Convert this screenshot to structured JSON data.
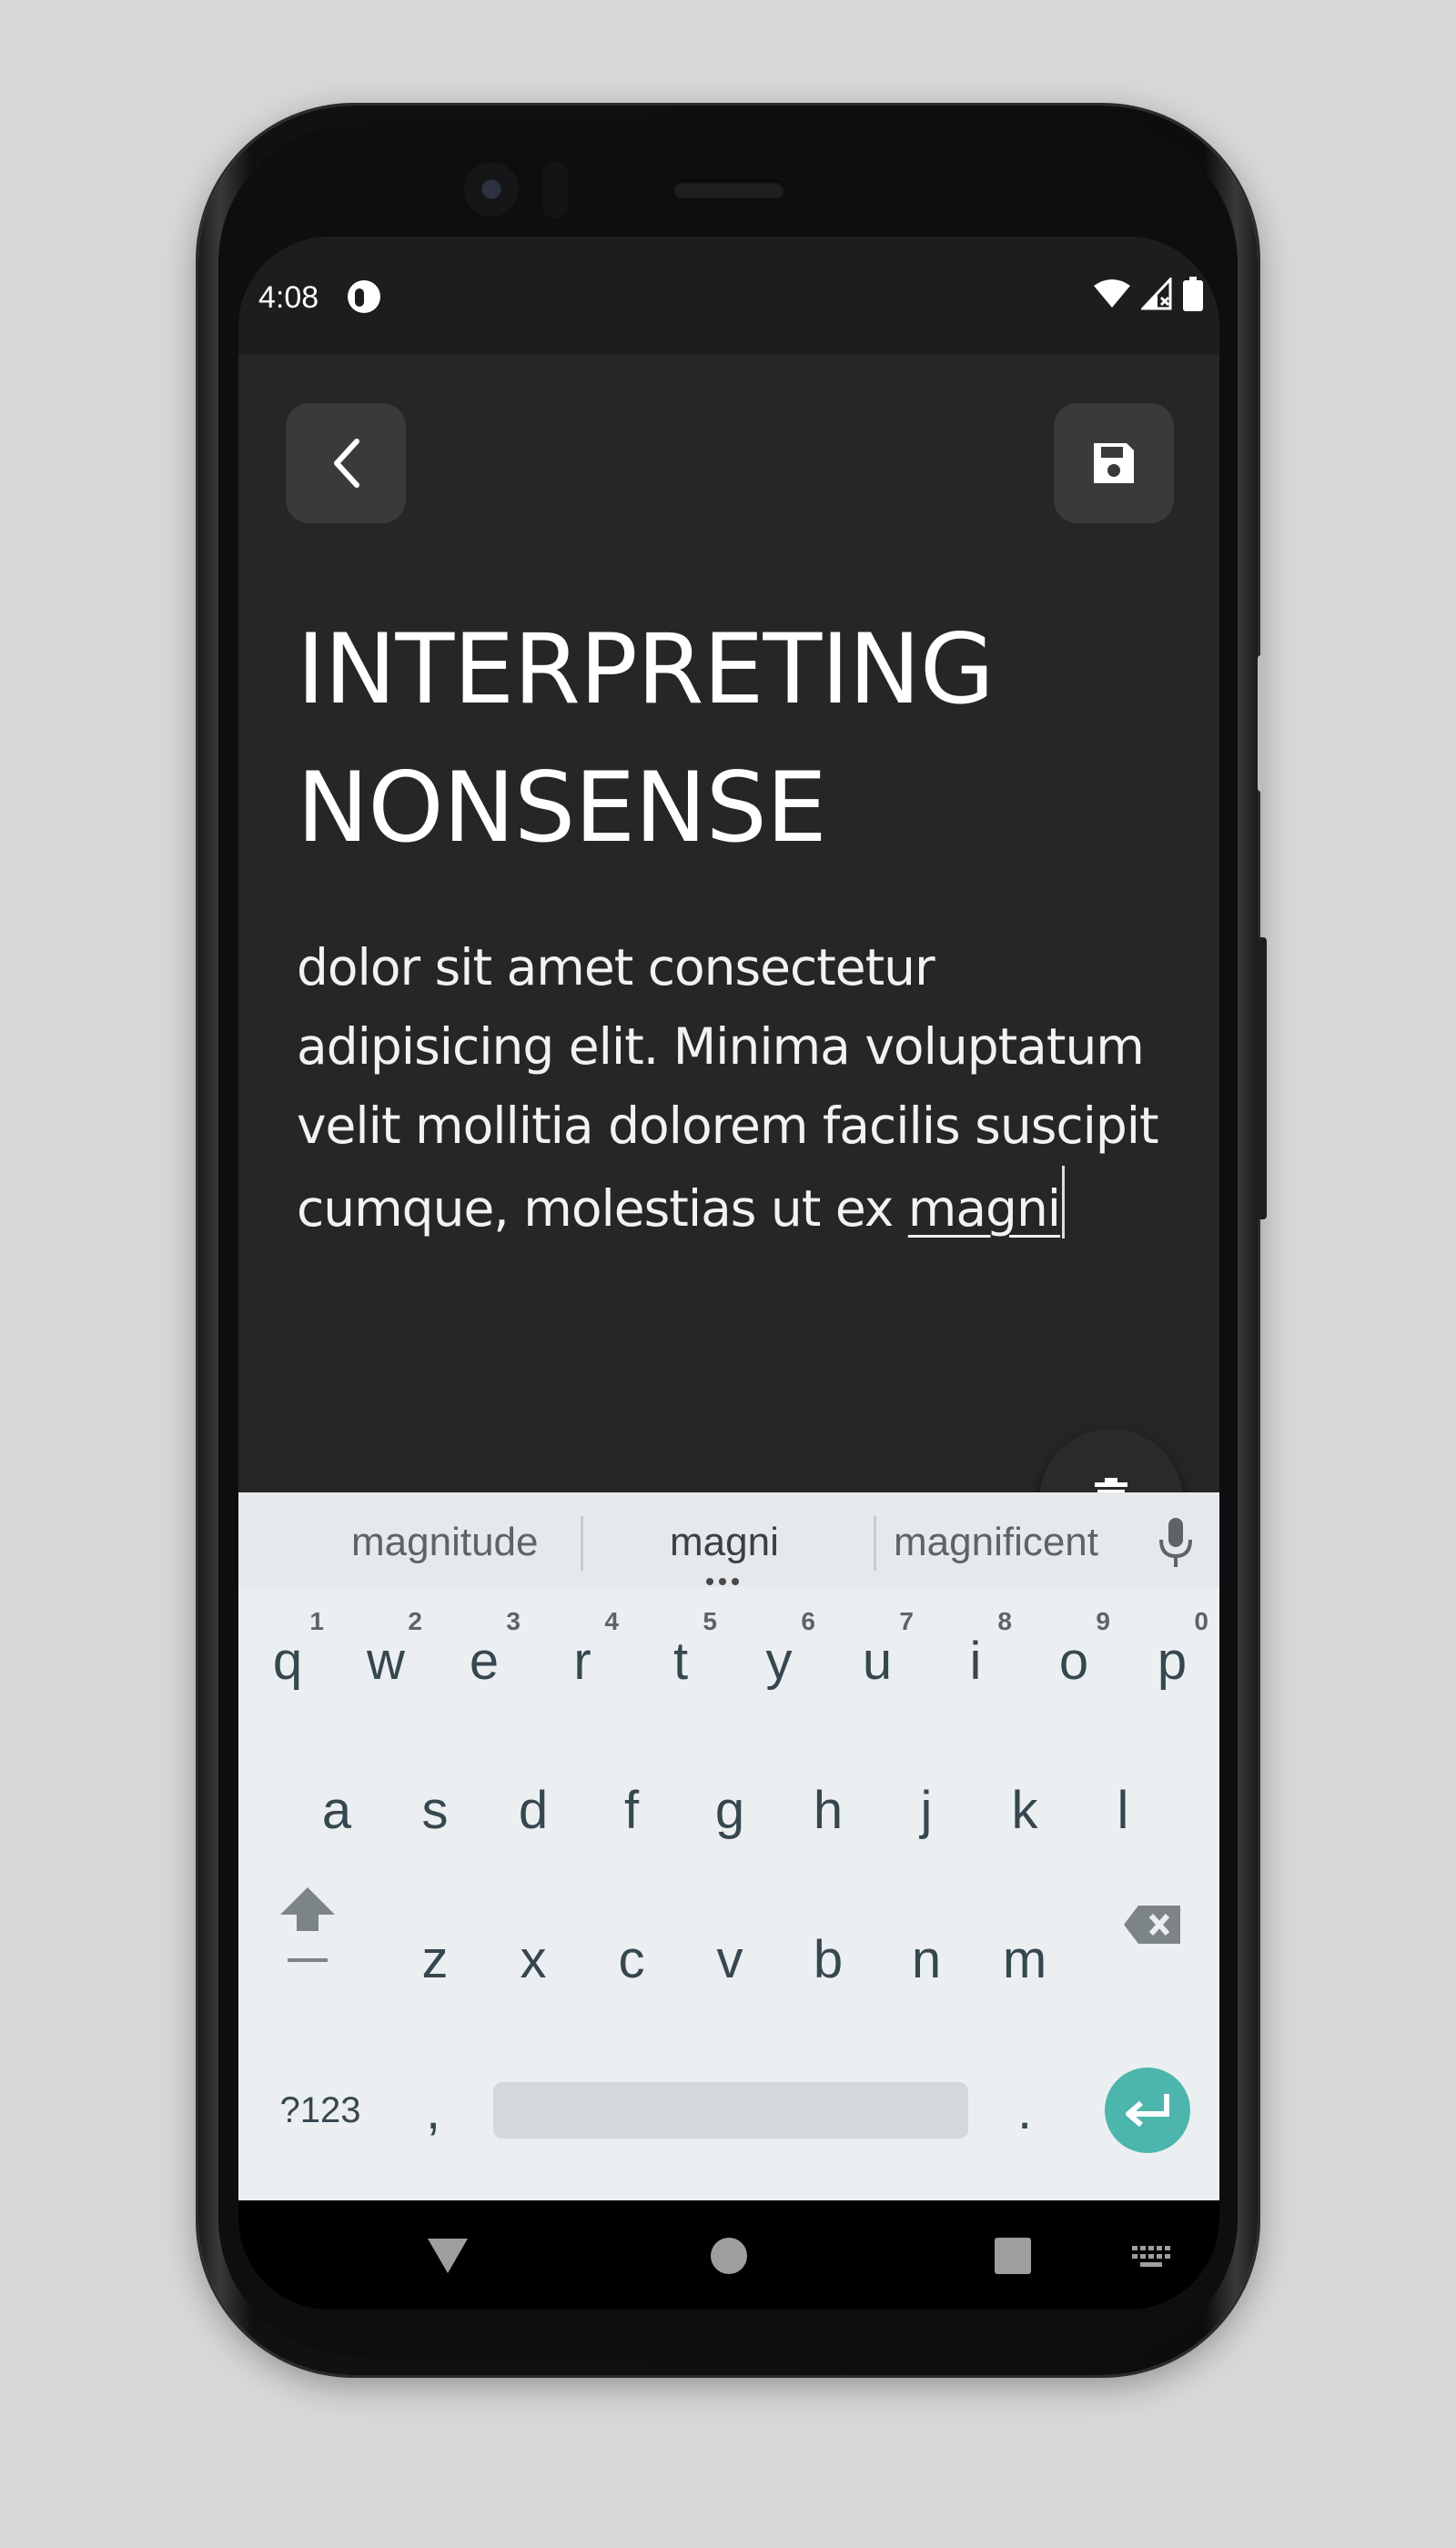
{
  "status": {
    "time": "4:08"
  },
  "note": {
    "title": "INTERPRETING NONSENSE",
    "body_text": "dolor sit amet consectetur adipisicing elit. Minima voluptatum velit mollitia dolorem facilis suscipit cumque, molestias ut ex ",
    "body_composing": "magni"
  },
  "keyboard": {
    "suggestions": [
      "magnitude",
      "magni",
      "magnificent"
    ],
    "row1": [
      {
        "k": "q",
        "h": "1"
      },
      {
        "k": "w",
        "h": "2"
      },
      {
        "k": "e",
        "h": "3"
      },
      {
        "k": "r",
        "h": "4"
      },
      {
        "k": "t",
        "h": "5"
      },
      {
        "k": "y",
        "h": "6"
      },
      {
        "k": "u",
        "h": "7"
      },
      {
        "k": "i",
        "h": "8"
      },
      {
        "k": "o",
        "h": "9"
      },
      {
        "k": "p",
        "h": "0"
      }
    ],
    "row2": [
      "a",
      "s",
      "d",
      "f",
      "g",
      "h",
      "j",
      "k",
      "l"
    ],
    "row3": [
      "z",
      "x",
      "c",
      "v",
      "b",
      "n",
      "m"
    ],
    "symbols_label": "?123",
    "comma_label": ",",
    "period_label": "."
  },
  "colors": {
    "accent": "#4db6ac",
    "app_bg": "#262626",
    "keyboard_bg": "#eceff1"
  },
  "icons": [
    "back-icon",
    "save-icon",
    "delete-icon",
    "mic-icon",
    "shift-icon",
    "backspace-icon",
    "enter-icon",
    "wifi-icon",
    "signal-icon",
    "battery-icon",
    "nav-back-icon",
    "nav-home-icon",
    "nav-recents-icon",
    "keyboard-switch-icon"
  ]
}
